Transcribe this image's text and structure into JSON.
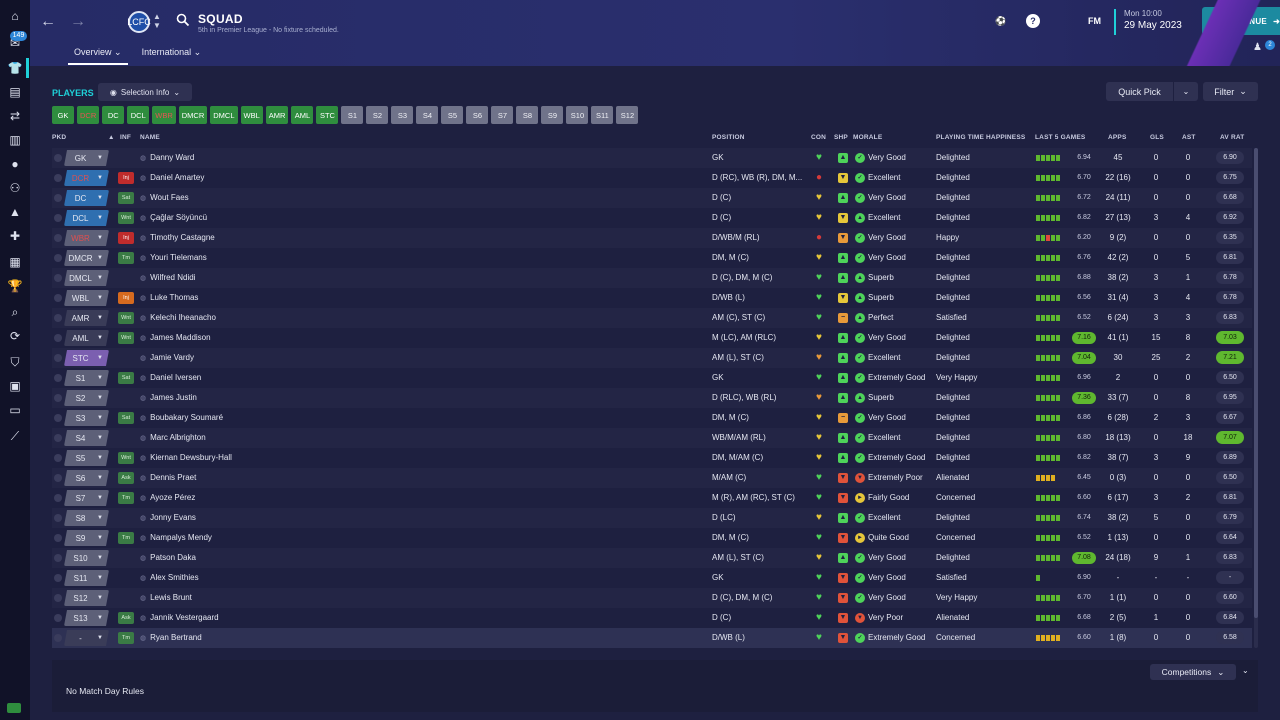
{
  "header": {
    "title": "SQUAD",
    "subtitle": "5th in Premier League - No fixture scheduled.",
    "tabs": [
      {
        "label": "Overview"
      },
      {
        "label": "International"
      }
    ],
    "fm": "FM",
    "date_day": "Mon 10:00",
    "date_full": "29 May 2023",
    "continue": "CONTINUE",
    "notif_count": "2",
    "club_short": "LCFC"
  },
  "sidebar": {
    "inbox_badge": "149"
  },
  "toolbar": {
    "players_label": "PLAYERS",
    "selection_info": "Selection Info",
    "quick_pick": "Quick Pick",
    "filter": "Filter"
  },
  "positions": [
    {
      "label": "GK",
      "style": "green"
    },
    {
      "label": "DCR",
      "style": "green-red"
    },
    {
      "label": "DC",
      "style": "green"
    },
    {
      "label": "DCL",
      "style": "green"
    },
    {
      "label": "WBR",
      "style": "green-red"
    },
    {
      "label": "DMCR",
      "style": "green"
    },
    {
      "label": "DMCL",
      "style": "green"
    },
    {
      "label": "WBL",
      "style": "green"
    },
    {
      "label": "AMR",
      "style": "green"
    },
    {
      "label": "AML",
      "style": "green"
    },
    {
      "label": "STC",
      "style": "green"
    },
    {
      "label": "S1",
      "style": "grey"
    },
    {
      "label": "S2",
      "style": "grey"
    },
    {
      "label": "S3",
      "style": "grey"
    },
    {
      "label": "S4",
      "style": "grey"
    },
    {
      "label": "S5",
      "style": "grey"
    },
    {
      "label": "S6",
      "style": "grey"
    },
    {
      "label": "S7",
      "style": "grey"
    },
    {
      "label": "S8",
      "style": "grey"
    },
    {
      "label": "S9",
      "style": "grey"
    },
    {
      "label": "S10",
      "style": "grey"
    },
    {
      "label": "S11",
      "style": "grey"
    },
    {
      "label": "S12",
      "style": "grey"
    }
  ],
  "columns": {
    "pkd": "PKD",
    "inf": "INF",
    "name": "NAME",
    "position": "POSITION",
    "con": "CON",
    "shp": "SHP",
    "morale": "MORALE",
    "happiness": "PLAYING TIME HAPPINESS",
    "last5": "LAST 5 GAMES",
    "apps": "APPS",
    "gls": "GLS",
    "ast": "AST",
    "avrat": "AV RAT"
  },
  "players": [
    {
      "pkd": "GK",
      "pkd_style": "grey",
      "inf": "",
      "inf_style": "",
      "name": "Danny Ward",
      "position": "GK",
      "con": "green",
      "shp": "up",
      "morale_icon": "good",
      "morale": "Very Good",
      "happiness": "Delighted",
      "form": [
        "g",
        "g",
        "g",
        "g",
        "g"
      ],
      "last5": "6.94",
      "last5_hi": false,
      "apps": "45",
      "gls": "0",
      "ast": "0",
      "avrat": "6.90",
      "avrat_hi": false
    },
    {
      "pkd": "DCR",
      "pkd_style": "blue-red",
      "inf": "Inj",
      "inf_style": "inj",
      "name": "Daniel Amartey",
      "position": "D (RC), WB (R), DM, M...",
      "con": "red-dot",
      "shp": "down",
      "morale_icon": "good",
      "morale": "Excellent",
      "happiness": "Delighted",
      "form": [
        "g",
        "g",
        "g",
        "g",
        "g"
      ],
      "last5": "6.70",
      "last5_hi": false,
      "apps": "22 (16)",
      "gls": "0",
      "ast": "0",
      "avrat": "6.75",
      "avrat_hi": false
    },
    {
      "pkd": "DC",
      "pkd_style": "blue",
      "inf": "Sat",
      "inf_style": "wnt",
      "name": "Wout Faes",
      "position": "D (C)",
      "con": "yellow",
      "shp": "up",
      "morale_icon": "good",
      "morale": "Very Good",
      "happiness": "Delighted",
      "form": [
        "g",
        "g",
        "g",
        "g",
        "g"
      ],
      "last5": "6.72",
      "last5_hi": false,
      "apps": "24 (11)",
      "gls": "0",
      "ast": "0",
      "avrat": "6.68",
      "avrat_hi": false
    },
    {
      "pkd": "DCL",
      "pkd_style": "blue",
      "inf": "Wnt",
      "inf_style": "wnt",
      "name": "Çağlar Söyüncü",
      "position": "D (C)",
      "con": "yellow",
      "shp": "down",
      "morale_icon": "up",
      "morale": "Excellent",
      "happiness": "Delighted",
      "form": [
        "g",
        "g",
        "g",
        "g",
        "g"
      ],
      "last5": "6.82",
      "last5_hi": false,
      "apps": "27 (13)",
      "gls": "3",
      "ast": "4",
      "avrat": "6.92",
      "avrat_hi": false
    },
    {
      "pkd": "WBR",
      "pkd_style": "grey-red",
      "inf": "Inj",
      "inf_style": "inj",
      "name": "Timothy Castagne",
      "position": "D/WB/M (RL)",
      "con": "red-dot",
      "shp": "orange",
      "morale_icon": "good",
      "morale": "Very Good",
      "happiness": "Happy",
      "form": [
        "g",
        "g",
        "r",
        "g",
        "g"
      ],
      "last5": "6.20",
      "last5_hi": false,
      "apps": "9 (2)",
      "gls": "0",
      "ast": "0",
      "avrat": "6.35",
      "avrat_hi": false
    },
    {
      "pkd": "DMCR",
      "pkd_style": "grey",
      "inf": "Tm",
      "inf_style": "wnt",
      "name": "Youri Tielemans",
      "position": "DM, M (C)",
      "con": "yellow",
      "shp": "up",
      "morale_icon": "good",
      "morale": "Very Good",
      "happiness": "Delighted",
      "form": [
        "g",
        "g",
        "g",
        "g",
        "g"
      ],
      "last5": "6.76",
      "last5_hi": false,
      "apps": "42 (2)",
      "gls": "0",
      "ast": "5",
      "avrat": "6.81",
      "avrat_hi": false
    },
    {
      "pkd": "DMCL",
      "pkd_style": "grey",
      "inf": "",
      "inf_style": "",
      "name": "Wilfred Ndidi",
      "position": "D (C), DM, M (C)",
      "con": "green",
      "shp": "up",
      "morale_icon": "up",
      "morale": "Superb",
      "happiness": "Delighted",
      "form": [
        "g",
        "g",
        "g",
        "g",
        "g"
      ],
      "last5": "6.88",
      "last5_hi": false,
      "apps": "38 (2)",
      "gls": "3",
      "ast": "1",
      "avrat": "6.78",
      "avrat_hi": false
    },
    {
      "pkd": "WBL",
      "pkd_style": "grey",
      "inf": "Inj",
      "inf_style": "org",
      "name": "Luke Thomas",
      "position": "D/WB (L)",
      "con": "green",
      "shp": "down",
      "morale_icon": "up",
      "morale": "Superb",
      "happiness": "Delighted",
      "form": [
        "g",
        "g",
        "g",
        "g",
        "g"
      ],
      "last5": "6.56",
      "last5_hi": false,
      "apps": "31 (4)",
      "gls": "3",
      "ast": "4",
      "avrat": "6.78",
      "avrat_hi": false
    },
    {
      "pkd": "AMR",
      "pkd_style": "dark",
      "inf": "Wnt",
      "inf_style": "wnt",
      "name": "Kelechi Iheanacho",
      "position": "AM (C), ST (C)",
      "con": "green",
      "shp": "orange-minus",
      "morale_icon": "up",
      "morale": "Perfect",
      "happiness": "Satisfied",
      "form": [
        "g",
        "g",
        "g",
        "g",
        "g"
      ],
      "last5": "6.52",
      "last5_hi": false,
      "apps": "6 (24)",
      "gls": "3",
      "ast": "3",
      "avrat": "6.83",
      "avrat_hi": false
    },
    {
      "pkd": "AML",
      "pkd_style": "dark",
      "inf": "Wnt",
      "inf_style": "wnt",
      "name": "James Maddison",
      "position": "M (LC), AM (RLC)",
      "con": "yellow",
      "shp": "up",
      "morale_icon": "good",
      "morale": "Very Good",
      "happiness": "Delighted",
      "form": [
        "g",
        "g",
        "g",
        "g",
        "g"
      ],
      "last5": "7.16",
      "last5_hi": true,
      "apps": "41 (1)",
      "gls": "15",
      "ast": "8",
      "avrat": "7.03",
      "avrat_hi": true
    },
    {
      "pkd": "STC",
      "pkd_style": "purple",
      "inf": "",
      "inf_style": "",
      "name": "Jamie Vardy",
      "position": "AM (L), ST (C)",
      "con": "orange",
      "shp": "up",
      "morale_icon": "good",
      "morale": "Excellent",
      "happiness": "Delighted",
      "form": [
        "g",
        "g",
        "g",
        "g",
        "g"
      ],
      "last5": "7.04",
      "last5_hi": true,
      "apps": "30",
      "gls": "25",
      "ast": "2",
      "avrat": "7.21",
      "avrat_hi": true
    },
    {
      "pkd": "S1",
      "pkd_style": "grey",
      "inf": "Sat",
      "inf_style": "wnt",
      "name": "Daniel Iversen",
      "position": "GK",
      "con": "green",
      "shp": "up",
      "morale_icon": "good",
      "morale": "Extremely Good",
      "happiness": "Very Happy",
      "form": [
        "g",
        "g",
        "g",
        "g",
        "g"
      ],
      "last5": "6.96",
      "last5_hi": false,
      "apps": "2",
      "gls": "0",
      "ast": "0",
      "avrat": "6.50",
      "avrat_hi": false
    },
    {
      "pkd": "S2",
      "pkd_style": "grey",
      "inf": "",
      "inf_style": "",
      "name": "James Justin",
      "position": "D (RLC), WB (RL)",
      "con": "orange",
      "shp": "up",
      "morale_icon": "up",
      "morale": "Superb",
      "happiness": "Delighted",
      "form": [
        "g",
        "g",
        "g",
        "g",
        "g"
      ],
      "last5": "7.36",
      "last5_hi": true,
      "apps": "33 (7)",
      "gls": "0",
      "ast": "8",
      "avrat": "6.95",
      "avrat_hi": false
    },
    {
      "pkd": "S3",
      "pkd_style": "grey",
      "inf": "Sat",
      "inf_style": "wnt",
      "name": "Boubakary Soumaré",
      "position": "DM, M (C)",
      "con": "yellow",
      "shp": "orange-minus",
      "morale_icon": "good",
      "morale": "Very Good",
      "happiness": "Delighted",
      "form": [
        "g",
        "g",
        "g",
        "g",
        "g"
      ],
      "last5": "6.86",
      "last5_hi": false,
      "apps": "6 (28)",
      "gls": "2",
      "ast": "3",
      "avrat": "6.67",
      "avrat_hi": false
    },
    {
      "pkd": "S4",
      "pkd_style": "grey",
      "inf": "",
      "inf_style": "",
      "name": "Marc Albrighton",
      "position": "WB/M/AM (RL)",
      "con": "yellow",
      "shp": "up",
      "morale_icon": "good",
      "morale": "Excellent",
      "happiness": "Delighted",
      "form": [
        "g",
        "g",
        "g",
        "g",
        "g"
      ],
      "last5": "6.80",
      "last5_hi": false,
      "apps": "18 (13)",
      "gls": "0",
      "ast": "18",
      "avrat": "7.07",
      "avrat_hi": true
    },
    {
      "pkd": "S5",
      "pkd_style": "grey",
      "inf": "Wnt",
      "inf_style": "wnt",
      "name": "Kiernan Dewsbury-Hall",
      "position": "DM, M/AM (C)",
      "con": "yellow",
      "shp": "up",
      "morale_icon": "good",
      "morale": "Extremely Good",
      "happiness": "Delighted",
      "form": [
        "g",
        "g",
        "g",
        "g",
        "g"
      ],
      "last5": "6.82",
      "last5_hi": false,
      "apps": "38 (7)",
      "gls": "3",
      "ast": "9",
      "avrat": "6.89",
      "avrat_hi": false
    },
    {
      "pkd": "S6",
      "pkd_style": "grey",
      "inf": "Ask",
      "inf_style": "ask",
      "name": "Dennis Praet",
      "position": "M/AM (C)",
      "con": "green",
      "shp": "red",
      "morale_icon": "bad",
      "morale": "Extremely Poor",
      "happiness": "Alienated",
      "form": [
        "y",
        "y",
        "y",
        "y"
      ],
      "last5": "6.45",
      "last5_hi": false,
      "apps": "0 (3)",
      "gls": "0",
      "ast": "0",
      "avrat": "6.50",
      "avrat_hi": false
    },
    {
      "pkd": "S7",
      "pkd_style": "grey",
      "inf": "Tm",
      "inf_style": "wnt",
      "name": "Ayoze Pérez",
      "position": "M (R), AM (RC), ST (C)",
      "con": "green",
      "shp": "red",
      "morale_icon": "ok",
      "morale": "Fairly Good",
      "happiness": "Concerned",
      "form": [
        "g",
        "g",
        "g",
        "g",
        "g"
      ],
      "last5": "6.60",
      "last5_hi": false,
      "apps": "6 (17)",
      "gls": "3",
      "ast": "2",
      "avrat": "6.81",
      "avrat_hi": false
    },
    {
      "pkd": "S8",
      "pkd_style": "grey",
      "inf": "",
      "inf_style": "",
      "name": "Jonny Evans",
      "position": "D (LC)",
      "con": "yellow",
      "shp": "up",
      "morale_icon": "good",
      "morale": "Excellent",
      "happiness": "Delighted",
      "form": [
        "g",
        "g",
        "g",
        "g",
        "g"
      ],
      "last5": "6.74",
      "last5_hi": false,
      "apps": "38 (2)",
      "gls": "5",
      "ast": "0",
      "avrat": "6.79",
      "avrat_hi": false
    },
    {
      "pkd": "S9",
      "pkd_style": "grey",
      "inf": "Tm",
      "inf_style": "wnt",
      "name": "Nampalys Mendy",
      "position": "DM, M (C)",
      "con": "green",
      "shp": "red",
      "morale_icon": "ok",
      "morale": "Quite Good",
      "happiness": "Concerned",
      "form": [
        "g",
        "g",
        "g",
        "g",
        "g"
      ],
      "last5": "6.52",
      "last5_hi": false,
      "apps": "1 (13)",
      "gls": "0",
      "ast": "0",
      "avrat": "6.64",
      "avrat_hi": false
    },
    {
      "pkd": "S10",
      "pkd_style": "grey",
      "inf": "",
      "inf_style": "",
      "name": "Patson Daka",
      "position": "AM (L), ST (C)",
      "con": "yellow",
      "shp": "up",
      "morale_icon": "good",
      "morale": "Very Good",
      "happiness": "Delighted",
      "form": [
        "g",
        "g",
        "g",
        "g",
        "g"
      ],
      "last5": "7.08",
      "last5_hi": true,
      "apps": "24 (18)",
      "gls": "9",
      "ast": "1",
      "avrat": "6.83",
      "avrat_hi": false
    },
    {
      "pkd": "S11",
      "pkd_style": "grey",
      "inf": "",
      "inf_style": "",
      "name": "Alex Smithies",
      "position": "GK",
      "con": "green",
      "shp": "red",
      "morale_icon": "good",
      "morale": "Very Good",
      "happiness": "Satisfied",
      "form": [
        "g"
      ],
      "last5": "6.90",
      "last5_hi": false,
      "apps": "-",
      "gls": "-",
      "ast": "-",
      "avrat": "-",
      "avrat_hi": false
    },
    {
      "pkd": "S12",
      "pkd_style": "grey",
      "inf": "",
      "inf_style": "",
      "name": "Lewis Brunt",
      "position": "D (C), DM, M (C)",
      "con": "green",
      "shp": "red",
      "morale_icon": "good",
      "morale": "Very Good",
      "happiness": "Very Happy",
      "form": [
        "g",
        "g",
        "g",
        "g",
        "g"
      ],
      "last5": "6.70",
      "last5_hi": false,
      "apps": "1 (1)",
      "gls": "0",
      "ast": "0",
      "avrat": "6.60",
      "avrat_hi": false
    },
    {
      "pkd": "S13",
      "pkd_style": "grey",
      "inf": "Ask",
      "inf_style": "ask",
      "name": "Jannik Vestergaard",
      "position": "D (C)",
      "con": "green",
      "shp": "red",
      "morale_icon": "bad",
      "morale": "Very Poor",
      "happiness": "Alienated",
      "form": [
        "g",
        "g",
        "g",
        "g",
        "g"
      ],
      "last5": "6.68",
      "last5_hi": false,
      "apps": "2 (5)",
      "gls": "1",
      "ast": "0",
      "avrat": "6.84",
      "avrat_hi": false
    },
    {
      "pkd": "-",
      "pkd_style": "dark",
      "inf": "Tm",
      "inf_style": "wnt",
      "name": "Ryan Bertrand",
      "position": "D/WB (L)",
      "con": "green",
      "shp": "red",
      "morale_icon": "good",
      "morale": "Extremely Good",
      "happiness": "Concerned",
      "form": [
        "y",
        "y",
        "y",
        "y",
        "y"
      ],
      "last5": "6.60",
      "last5_hi": false,
      "apps": "1 (8)",
      "gls": "0",
      "ast": "0",
      "avrat": "6.58",
      "avrat_hi": false
    }
  ],
  "footer": {
    "no_rules": "No Match Day Rules",
    "competitions": "Competitions"
  },
  "colors": {
    "accent": "#1fd0d8",
    "green": "#2f8d3e",
    "form_green": "#5fb82f",
    "form_yellow": "#e0b020",
    "form_red": "#e04a3a"
  }
}
